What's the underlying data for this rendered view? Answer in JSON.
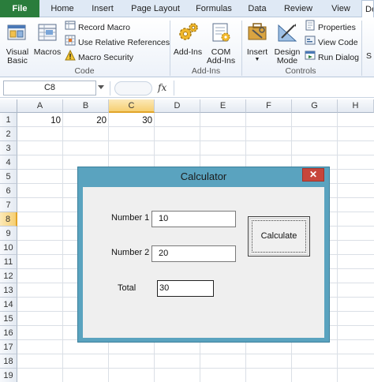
{
  "tabs": [
    {
      "label": "File",
      "active": false,
      "file": true
    },
    {
      "label": "Home",
      "active": false
    },
    {
      "label": "Insert",
      "active": false
    },
    {
      "label": "Page Layout",
      "active": false
    },
    {
      "label": "Formulas",
      "active": false
    },
    {
      "label": "Data",
      "active": false
    },
    {
      "label": "Review",
      "active": false
    },
    {
      "label": "View",
      "active": false
    },
    {
      "label": "Developer",
      "active": true
    }
  ],
  "ribbon": {
    "code": {
      "group_label": "Code",
      "visual_basic": "Visual Basic",
      "macros": "Macros",
      "record_macro": "Record Macro",
      "use_relative": "Use Relative References",
      "macro_security": "Macro Security"
    },
    "addins": {
      "group_label": "Add-Ins",
      "addins": "Add-Ins",
      "com_addins": "COM Add-Ins"
    },
    "controls": {
      "group_label": "Controls",
      "insert": "Insert",
      "design_mode": "Design Mode",
      "properties": "Properties",
      "view_code": "View Code",
      "run_dialog": "Run Dialog"
    },
    "overflow_letter": "S"
  },
  "formula_bar": {
    "name_box": "C8",
    "fx": "fx",
    "value": ""
  },
  "grid": {
    "columns": [
      "A",
      "B",
      "C",
      "D",
      "E",
      "F",
      "G",
      "H"
    ],
    "selected_column": "C",
    "rows": [
      "1",
      "2",
      "3",
      "4",
      "5",
      "6",
      "7",
      "8",
      "9",
      "10",
      "11",
      "12",
      "13",
      "14",
      "15",
      "16",
      "17",
      "18",
      "19"
    ],
    "selected_row": "8",
    "cells": {
      "A1": "10",
      "B1": "20",
      "C1": "30"
    }
  },
  "dialog": {
    "title": "Calculator",
    "close": "✕",
    "number1_label": "Number 1",
    "number1_value": "10",
    "number2_label": "Number 2",
    "number2_value": "20",
    "total_label": "Total",
    "total_value": "30",
    "calculate_label": "Calculate"
  },
  "colors": {
    "file_tab": "#2a7d3c",
    "dialog_frame": "#5aa3bf",
    "close_button": "#c7463b",
    "selection_header": "#f6cf72"
  }
}
